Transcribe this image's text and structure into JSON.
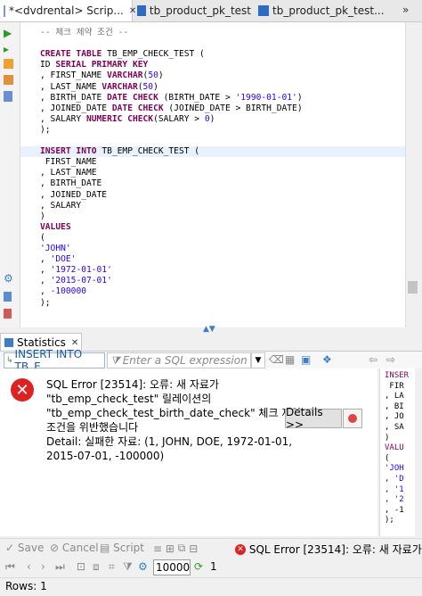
{
  "tabs": [
    {
      "label": "*<dvdrental> Scrip...",
      "active": true
    },
    {
      "label": "tb_product_pk_test",
      "active": false
    },
    {
      "label": "tb_product_pk_test...",
      "active": false
    }
  ],
  "editor": {
    "lines": [
      {
        "segments": [
          {
            "t": "-- 체크 제약 조건 --",
            "c": "cm"
          }
        ]
      },
      {
        "segments": [
          {
            "t": "",
            "c": ""
          }
        ]
      },
      {
        "segments": [
          {
            "t": "CREATE TABLE",
            "c": "kw"
          },
          {
            "t": " TB_EMP_CHECK_TEST (",
            "c": ""
          }
        ]
      },
      {
        "segments": [
          {
            "t": "ID ",
            "c": ""
          },
          {
            "t": "SERIAL PRIMARY KEY",
            "c": "kw"
          }
        ]
      },
      {
        "segments": [
          {
            "t": ", FIRST_NAME ",
            "c": ""
          },
          {
            "t": "VARCHAR",
            "c": "kw"
          },
          {
            "t": "(",
            "c": ""
          },
          {
            "t": "50",
            "c": "num"
          },
          {
            "t": ")",
            "c": ""
          }
        ]
      },
      {
        "segments": [
          {
            "t": ", LAST_NAME ",
            "c": ""
          },
          {
            "t": "VARCHAR",
            "c": "kw"
          },
          {
            "t": "(",
            "c": ""
          },
          {
            "t": "50",
            "c": "num"
          },
          {
            "t": ")",
            "c": ""
          }
        ]
      },
      {
        "segments": [
          {
            "t": ", BIRTH_DATE ",
            "c": ""
          },
          {
            "t": "DATE CHECK",
            "c": "kw"
          },
          {
            "t": " (BIRTH_DATE > ",
            "c": ""
          },
          {
            "t": "'1990-01-01'",
            "c": "str"
          },
          {
            "t": ")",
            "c": ""
          }
        ]
      },
      {
        "segments": [
          {
            "t": ", JOINED_DATE ",
            "c": ""
          },
          {
            "t": "DATE CHECK",
            "c": "kw"
          },
          {
            "t": " (JOINED_DATE > BIRTH_DATE)",
            "c": ""
          }
        ]
      },
      {
        "segments": [
          {
            "t": ", SALARY ",
            "c": ""
          },
          {
            "t": "NUMERIC CHECK",
            "c": "kw"
          },
          {
            "t": "(SALARY > ",
            "c": ""
          },
          {
            "t": "0",
            "c": "num"
          },
          {
            "t": ")",
            "c": ""
          }
        ]
      },
      {
        "segments": [
          {
            "t": ");",
            "c": ""
          }
        ]
      },
      {
        "segments": [
          {
            "t": "",
            "c": ""
          }
        ]
      },
      {
        "segments": [
          {
            "t": "INSERT INTO",
            "c": "kw"
          },
          {
            "t": " TB_EMP_CHECK_TEST (",
            "c": ""
          }
        ],
        "hl": true
      },
      {
        "segments": [
          {
            "t": " FIRST_NAME",
            "c": ""
          }
        ]
      },
      {
        "segments": [
          {
            "t": ", LAST_NAME",
            "c": ""
          }
        ]
      },
      {
        "segments": [
          {
            "t": ", BIRTH_DATE",
            "c": ""
          }
        ]
      },
      {
        "segments": [
          {
            "t": ", JOINED_DATE",
            "c": ""
          }
        ]
      },
      {
        "segments": [
          {
            "t": ", SALARY",
            "c": ""
          }
        ]
      },
      {
        "segments": [
          {
            "t": ")",
            "c": ""
          }
        ]
      },
      {
        "segments": [
          {
            "t": "VALUES",
            "c": "kw"
          }
        ]
      },
      {
        "segments": [
          {
            "t": "(",
            "c": ""
          }
        ]
      },
      {
        "segments": [
          {
            "t": "'JOHN'",
            "c": "str"
          }
        ]
      },
      {
        "segments": [
          {
            "t": ", ",
            "c": ""
          },
          {
            "t": "'DOE'",
            "c": "str"
          }
        ]
      },
      {
        "segments": [
          {
            "t": ", ",
            "c": ""
          },
          {
            "t": "'1972-01-01'",
            "c": "str"
          }
        ]
      },
      {
        "segments": [
          {
            "t": ", ",
            "c": ""
          },
          {
            "t": "'2015-07-01'",
            "c": "str"
          }
        ]
      },
      {
        "segments": [
          {
            "t": ", ",
            "c": ""
          },
          {
            "t": "-100000",
            "c": "num"
          }
        ]
      },
      {
        "segments": [
          {
            "t": ");",
            "c": ""
          }
        ]
      }
    ]
  },
  "results": {
    "tab_label": "Statistics",
    "sql_select_value": "INSERT INTO TB_E",
    "sql_expression_placeholder": "Enter a SQL expression",
    "error_lines": [
      "SQL Error [23514]: 오류: 새 자료가",
      "\"tb_emp_check_test\" 릴레이션의",
      "\"tb_emp_check_test_birth_date_check\" 체크 제약",
      "조건을 위반했습니다",
      "  Detail: 실패한 자료: (1, JOHN, DOE, 1972-01-01,",
      "2015-07-01, -100000)"
    ],
    "details_label": "Details >>",
    "side_preview": [
      "INSER",
      " FIR",
      ", LA",
      ", BI",
      ", JO",
      ", SA",
      ")",
      "VALU",
      "(",
      "'JOH",
      ", 'D",
      ", '1",
      ", '2",
      ", -1",
      ");"
    ]
  },
  "bottom": {
    "save_label": "Save",
    "cancel_label": "Cancel",
    "script_label": "Script",
    "status_error": "SQL Error [23514]: 오류: 새 자료가 '",
    "fetch_size": "10000",
    "refresh_count": "1",
    "rows_label": "Rows: 1"
  }
}
